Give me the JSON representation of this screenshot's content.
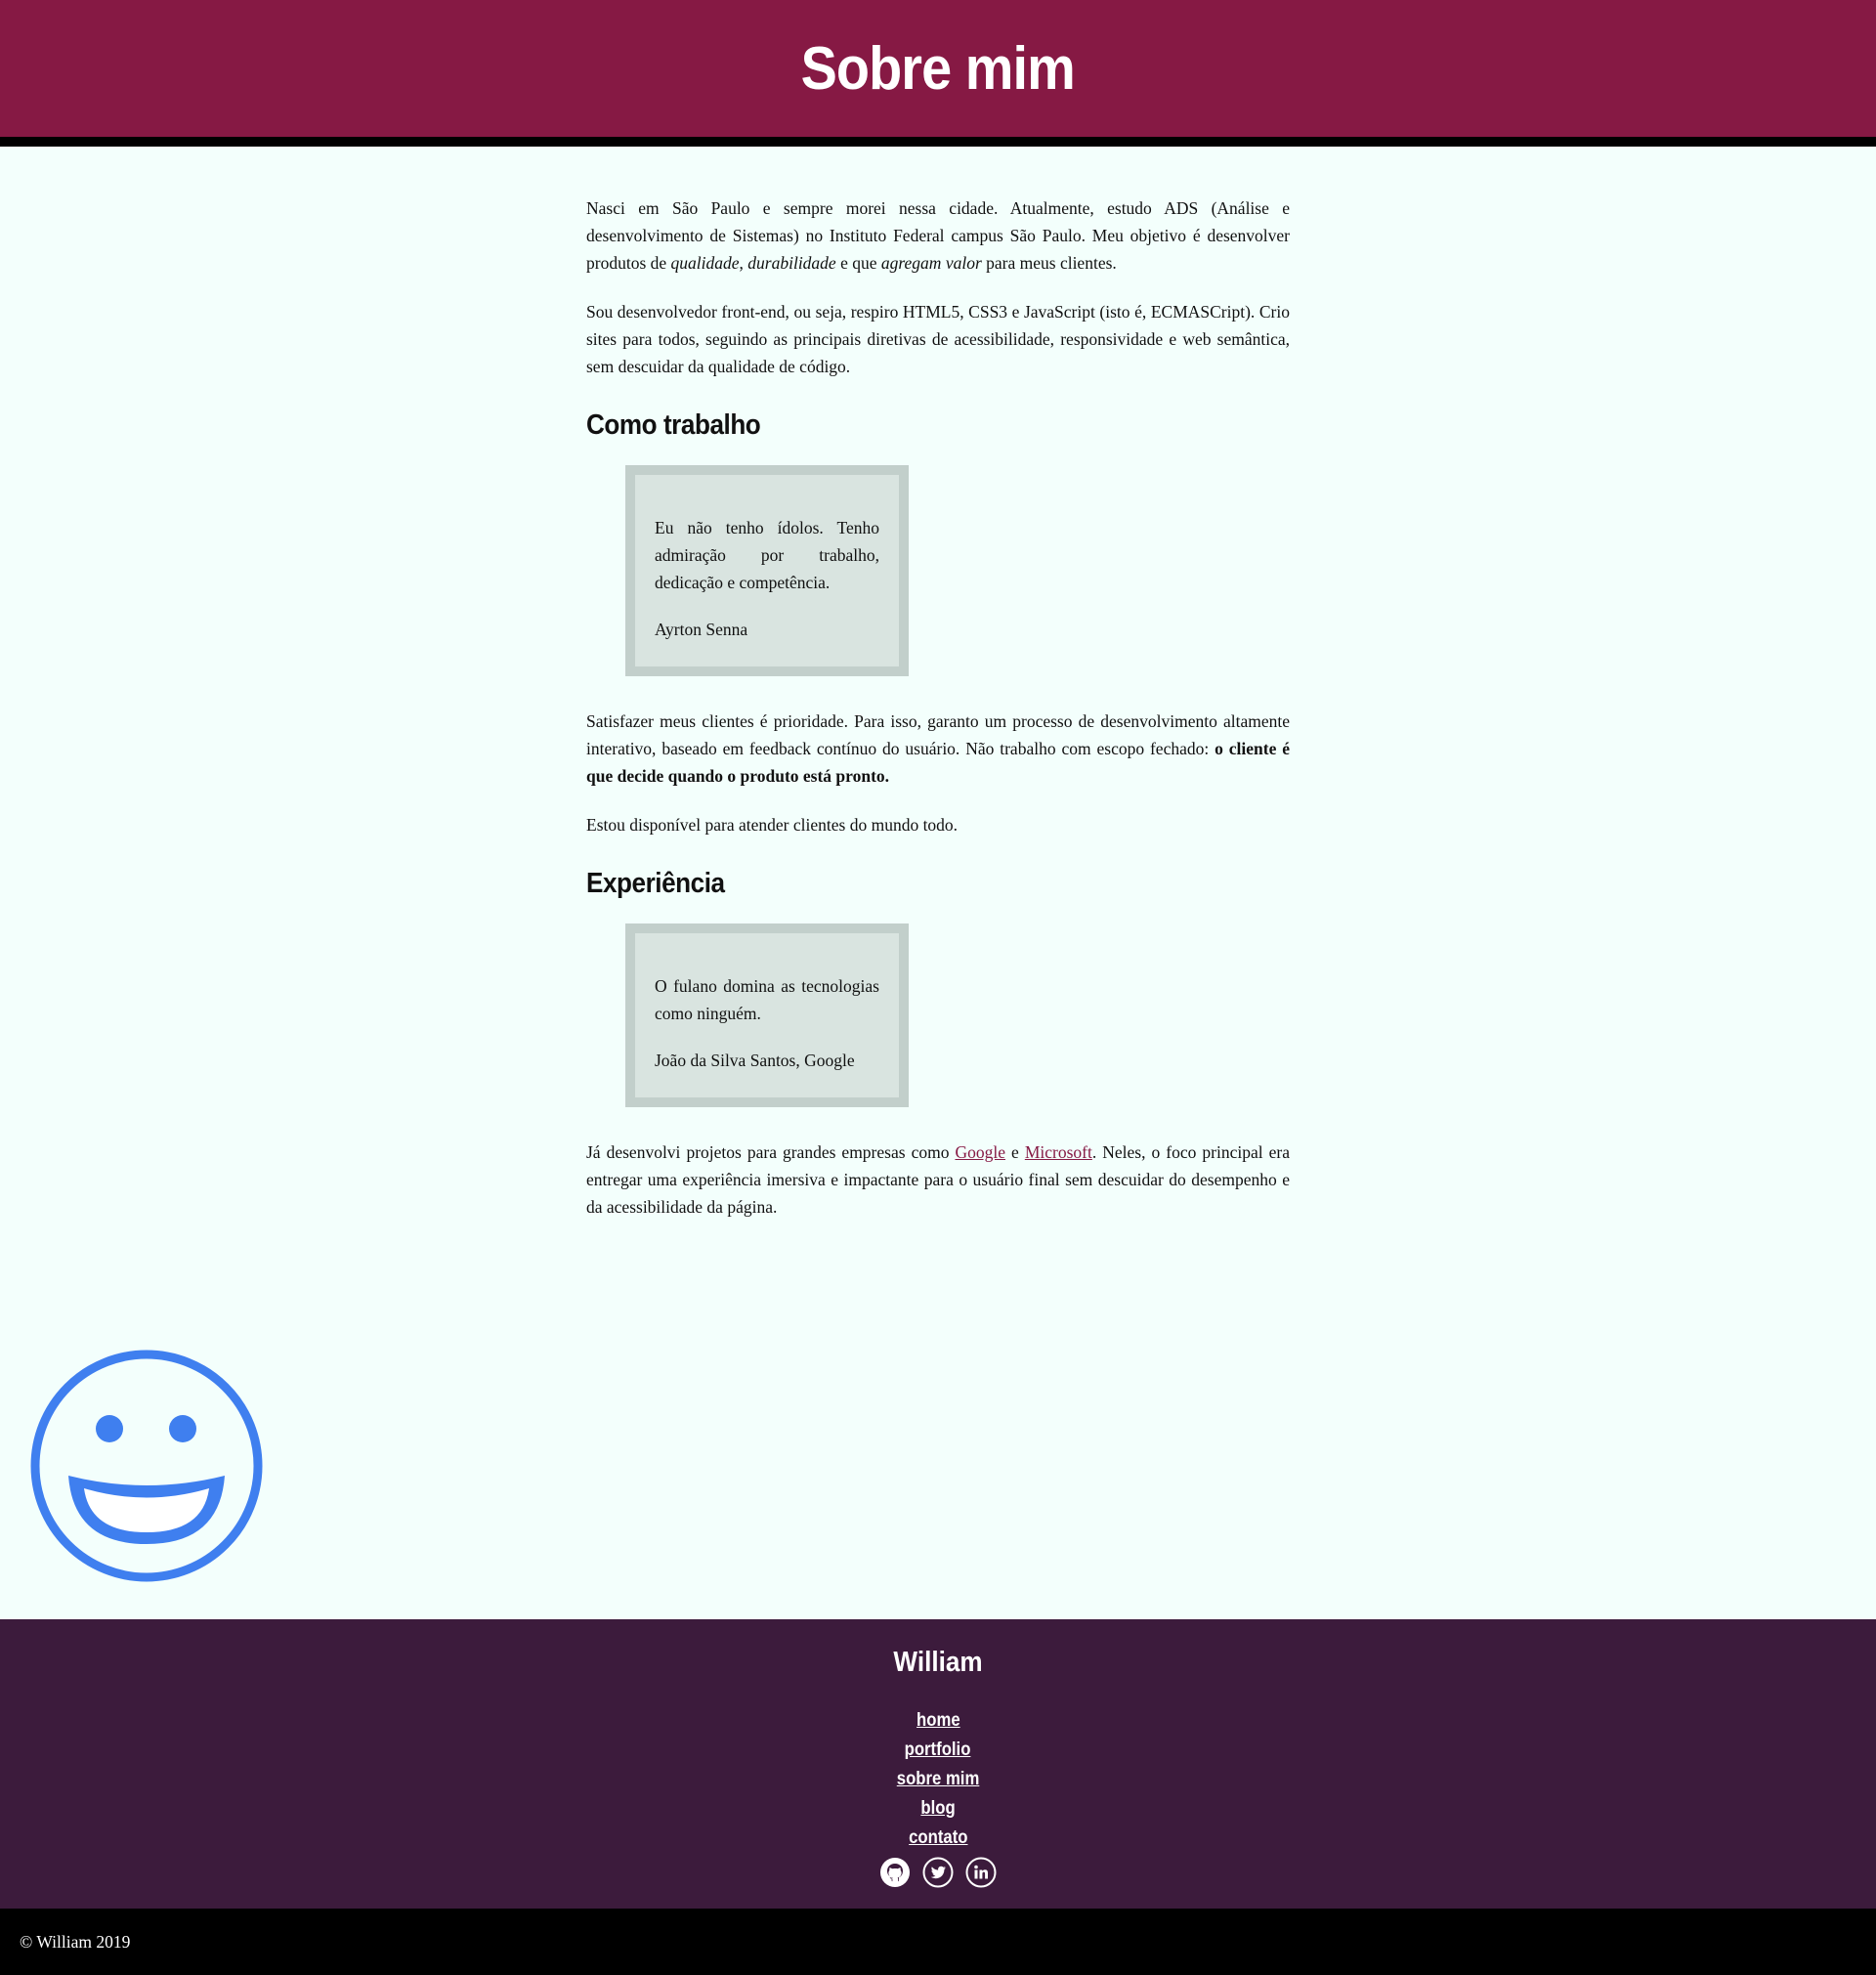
{
  "header": {
    "title": "Sobre mim"
  },
  "intro": {
    "p1": {
      "before": "Nasci em São Paulo e sempre morei nessa cidade. Atualmente, estudo ADS (Análise e desenvolvimento de Sistemas) no Instituto Federal campus São Paulo. Meu objetivo é desenvolver produtos de ",
      "em1": "qualidade",
      "sep": ", ",
      "em2": "durabilidade",
      "mid": " e que ",
      "em3": "agregam valor",
      "after": " para meus clientes."
    },
    "p2": "Sou desenvolvedor front-end, ou seja, respiro HTML5, CSS3 e JavaScript (isto é, ECMASCript). Crio sites para todos, seguindo as principais diretivas de acessibilidade, responsividade e web semântica, sem descuidar da qualidade de código."
  },
  "section_work": {
    "heading": "Como trabalho",
    "quote": {
      "text": "Eu não tenho ídolos. Tenho admiração por trabalho, dedicação e competência.",
      "author": "Ayrton Senna"
    },
    "p1_before": "Satisfazer meus clientes é prioridade. Para isso, garanto um processo de desenvolvimento altamente interativo, baseado em feedback contínuo do usuário. Não trabalho com escopo fechado: ",
    "p1_strong": "o cliente é que decide quando o produto está pronto.",
    "p2": "Estou disponível para atender clientes do mundo todo."
  },
  "section_experience": {
    "heading": "Experiência",
    "quote": {
      "text": "O fulano domina as tecnologias como ninguém.",
      "author": "João da Silva Santos, Google"
    },
    "p_before": "Já desenvolvi projetos para grandes empresas como ",
    "link1": "Google",
    "p_mid": " e ",
    "link2": "Microsoft",
    "p_after": ". Neles, o foco principal era entregar uma experiência imersiva e impactante para o usuário final sem descuidar do desempenho e da acessibilidade da página."
  },
  "decoration": {
    "icon": "grinning-face-icon",
    "color": "#3f7fef"
  },
  "footer": {
    "name": "William",
    "nav": [
      "home",
      "portfolio",
      "sobre mim",
      "blog",
      "contato"
    ],
    "social": [
      "github-icon",
      "twitter-icon",
      "linkedin-icon"
    ]
  },
  "copyright": "© William 2019",
  "colors": {
    "header_bg": "#861944",
    "page_bg": "#f3fffc",
    "quote_bg": "#d9e4e0",
    "quote_border": "#c2cfcb",
    "footer_bg": "#3c1b3c",
    "bottom_bar": "#000000",
    "link": "#861944"
  }
}
